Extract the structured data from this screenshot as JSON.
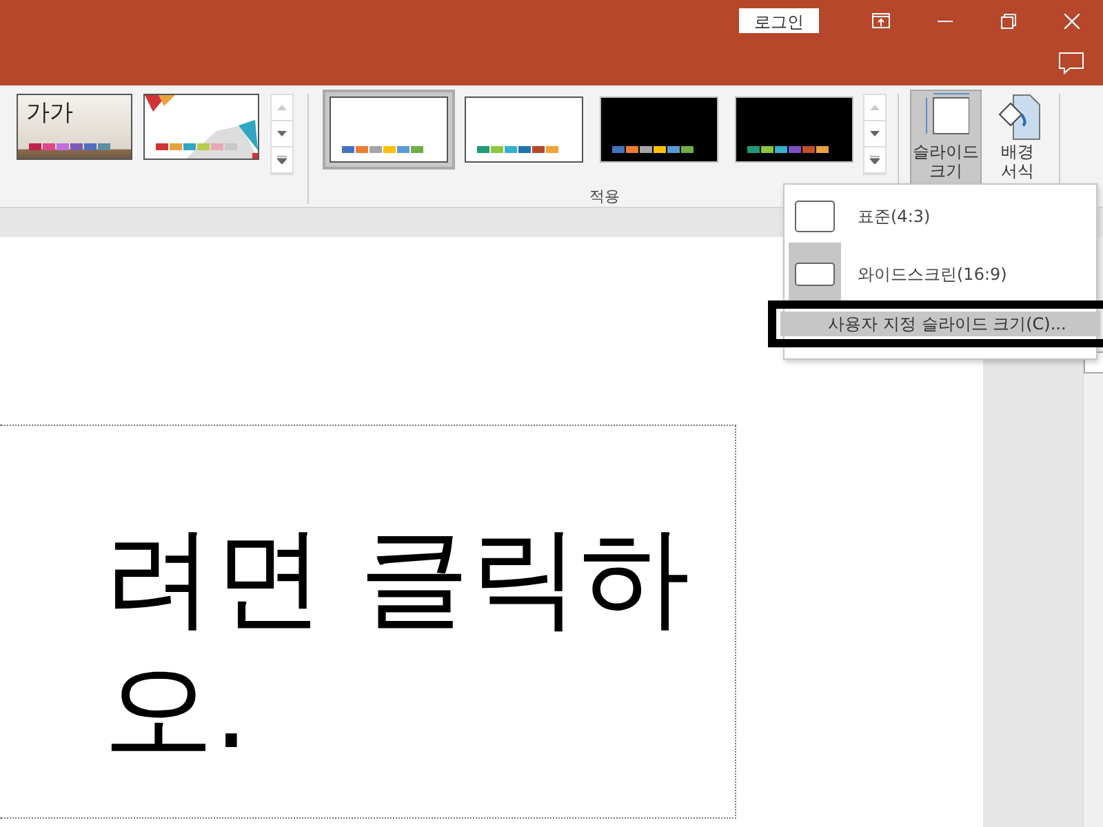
{
  "title_bar": {
    "login_button": "로그인"
  },
  "ribbon": {
    "themes": [
      {
        "kind": "photo",
        "label": "가가",
        "swatches": [
          {
            "color": "#c0234a"
          },
          {
            "color": "#e0468a"
          },
          {
            "color": "#c26ee0"
          },
          {
            "color": "#7c5cb8"
          },
          {
            "color": "#4f6fbf"
          },
          {
            "color": "#5d8ea0"
          }
        ]
      },
      {
        "kind": "facet",
        "swatches": [
          {
            "color": "#d13438"
          },
          {
            "color": "#e8a33d"
          },
          {
            "color": "#2fa7c1"
          },
          {
            "color": "#b5cc4c"
          },
          {
            "color": "#e8a7b6"
          },
          {
            "color": "#c8c8c8"
          }
        ]
      }
    ],
    "variants": [
      {
        "selected": true,
        "kind": "light",
        "swatches": [
          {
            "color": "#4472c4"
          },
          {
            "color": "#ed7d31"
          },
          {
            "color": "#a5a5a5"
          },
          {
            "color": "#ffc000"
          },
          {
            "color": "#5b9bd5"
          },
          {
            "color": "#70ad47"
          }
        ]
      },
      {
        "selected": false,
        "kind": "light",
        "swatches": [
          {
            "color": "#1e9b76"
          },
          {
            "color": "#8dc63f"
          },
          {
            "color": "#35b0cf"
          },
          {
            "color": "#2271b1"
          },
          {
            "color": "#b5472a"
          },
          {
            "color": "#f2a336"
          }
        ]
      },
      {
        "selected": false,
        "kind": "dark",
        "swatches": [
          {
            "color": "#4472c4"
          },
          {
            "color": "#ed7d31"
          },
          {
            "color": "#a5a5a5"
          },
          {
            "color": "#ffc000"
          },
          {
            "color": "#5b9bd5"
          },
          {
            "color": "#70ad47"
          }
        ]
      },
      {
        "selected": false,
        "kind": "dark",
        "swatches": [
          {
            "color": "#1e9b76"
          },
          {
            "color": "#8dc63f"
          },
          {
            "color": "#35b0cf"
          },
          {
            "color": "#7a52c7"
          },
          {
            "color": "#c4502a"
          },
          {
            "color": "#e8a33d"
          }
        ]
      }
    ],
    "group_label": "적용",
    "slide_size_button": {
      "label": "슬라이드\n크기",
      "pressed": true
    },
    "background_button": {
      "label": "배경\n서식"
    }
  },
  "menu": {
    "items": [
      {
        "label": "표준(4:3)",
        "kind": "size",
        "selected": false
      },
      {
        "label": "와이드스크린(16:9)",
        "kind": "size",
        "selected": true
      },
      {
        "label": "사용자 지정 슬라이드 크기(C)...",
        "kind": "command",
        "highlighted": true
      }
    ]
  },
  "slide": {
    "title_lines": [
      "려면 클릭하",
      "오."
    ]
  }
}
